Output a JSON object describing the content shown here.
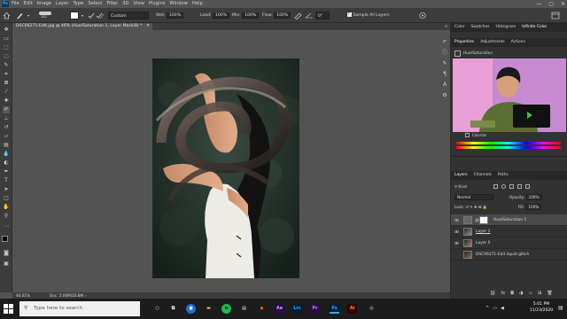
{
  "menubar": {
    "logo": "Ps",
    "items": [
      "File",
      "Edit",
      "Image",
      "Layer",
      "Type",
      "Select",
      "Filter",
      "3D",
      "View",
      "Plugins",
      "Window",
      "Help"
    ],
    "window_controls": [
      "—",
      "▢",
      "✕"
    ]
  },
  "options": {
    "brush_size": "282",
    "blend_mode": "Custom",
    "mode_label": "Wet:",
    "wet_value": "100%",
    "load_label": "Load:",
    "load_value": "100%",
    "mix_label": "Mix:",
    "mix_value": "100%",
    "flow_label": "Flow:",
    "flow_value": "100%",
    "angle_value": "0°",
    "sample_all_label": "Sample All Layers"
  },
  "document": {
    "tab_title": "DSC06271-Edit.jpg @ 46% (Hue/Saturation 1, Layer Mask/8) *",
    "zoom": "46.01%",
    "doc_size": "Doc: 5.00M/16.8M"
  },
  "panels": {
    "top_tabs": [
      "Color",
      "Swatches",
      "Histogram",
      "Infinite Color"
    ],
    "top_active": "Infinite Color",
    "props_tabs": [
      "Properties",
      "Adjustments",
      "Actions"
    ],
    "props_active": "Properties",
    "props_header": "Hue/Saturation",
    "colorize_label": "Colorize",
    "layers_tabs": [
      "Layers",
      "Channels",
      "Paths"
    ],
    "layers_active": "Layers",
    "kind_label": "Kind",
    "blend_mode": "Normal",
    "opacity_label": "Opacity:",
    "opacity_value": "100%",
    "lock_label": "Lock:",
    "fill_label": "Fill:",
    "fill_value": "100%",
    "layers": [
      {
        "name": "Hue/Saturation 1",
        "selected": true
      },
      {
        "name": "Layer 1",
        "selected": false
      },
      {
        "name": "Layer 0",
        "selected": false
      },
      {
        "name": "DSC06271-Edit liquid glitch",
        "selected": false
      }
    ]
  },
  "taskbar": {
    "search_placeholder": "Type here to search",
    "time": "5:01 PM",
    "date": "11/23/2020",
    "apps": [
      "Ae",
      "Lrc",
      "Pr",
      "Ps",
      "Ai"
    ]
  },
  "colors": {
    "accent_blue": "#31a8ff",
    "ps_dark": "#0a3b66",
    "panel_bg": "#323232",
    "ui_bg": "#535353"
  }
}
